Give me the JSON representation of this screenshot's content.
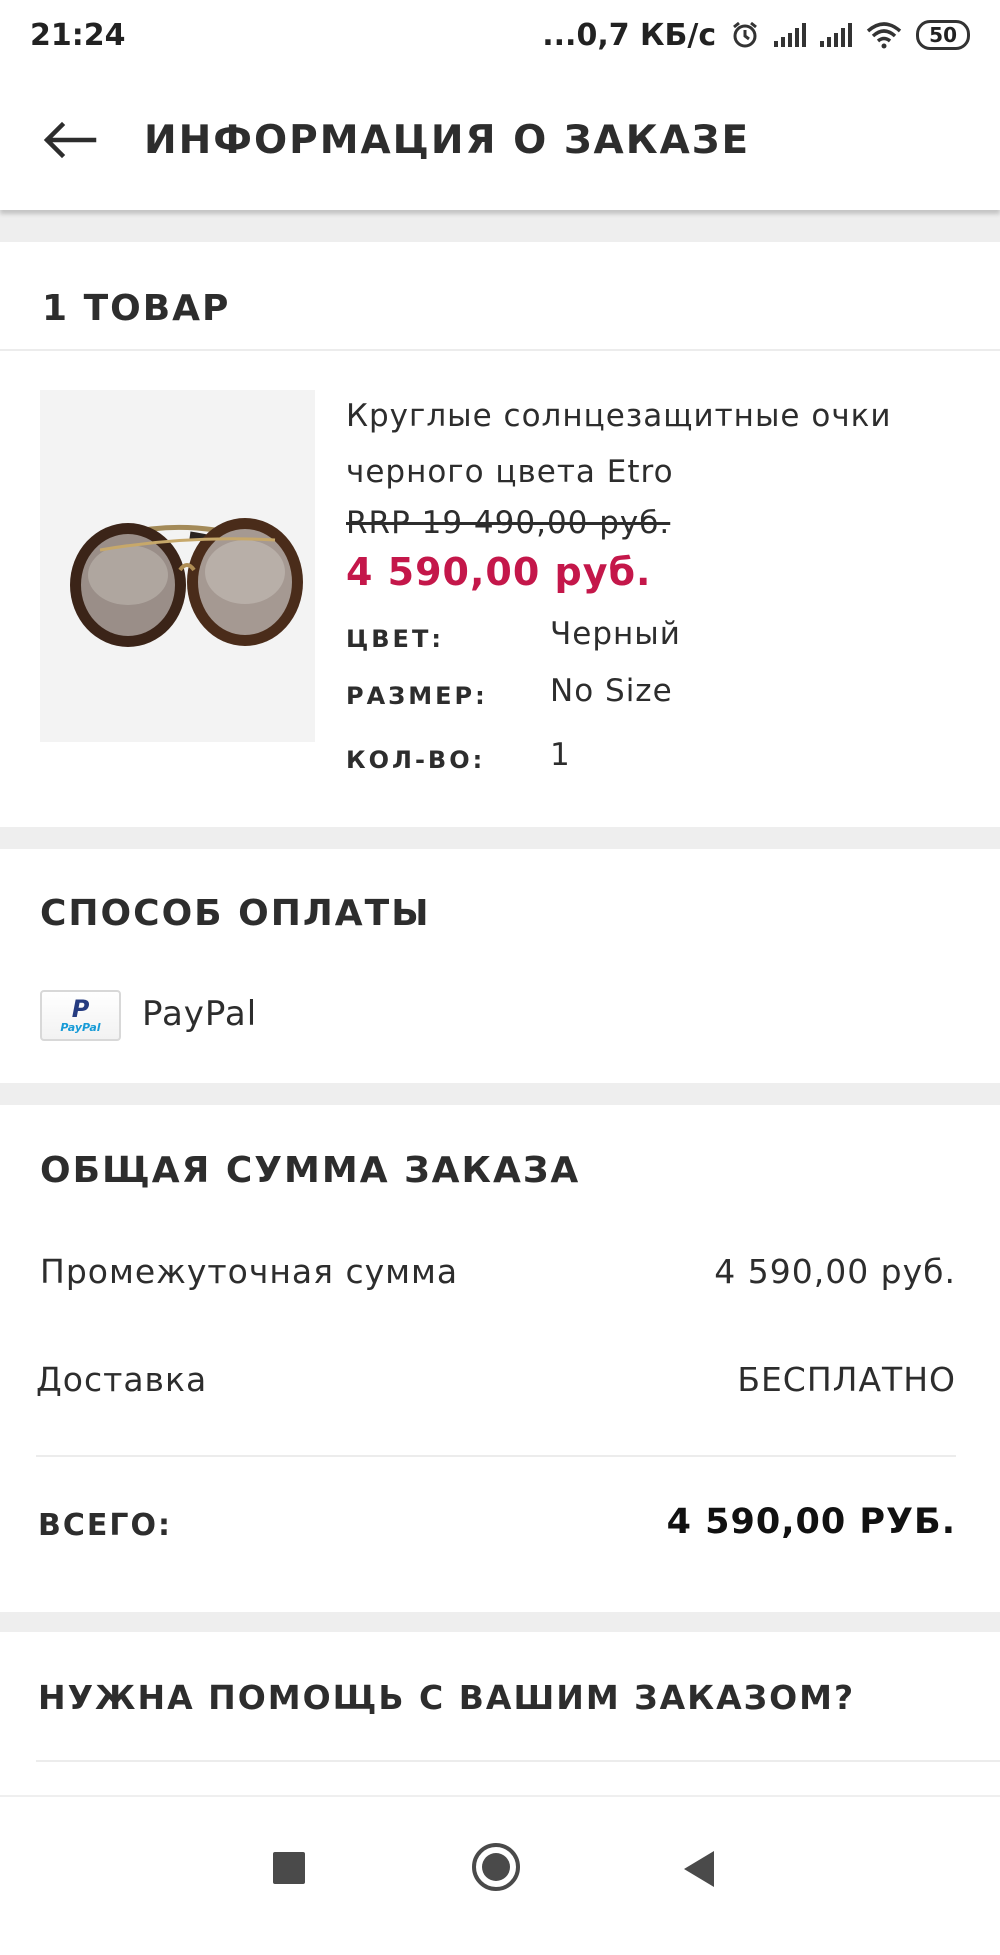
{
  "status_bar": {
    "time": "21:24",
    "network_speed": "...0,7 КБ/с",
    "battery": "50"
  },
  "header": {
    "title": "ИНФОРМАЦИЯ О ЗАКАЗЕ"
  },
  "items_section": {
    "title": "1 ТОВАР",
    "product": {
      "name": "Круглые солнцезащитные очки черного цвета Etro",
      "rrp": "RRP 19 490,00 руб.",
      "price": "4 590,00 руб.",
      "attributes": [
        {
          "label": "ЦВЕТ:",
          "value": "Черный"
        },
        {
          "label": "РАЗМЕР:",
          "value": "No Size"
        },
        {
          "label": "КОЛ-ВО:",
          "value": "1"
        }
      ]
    }
  },
  "payment": {
    "title": "СПОСОБ ОПЛАТЫ",
    "method": "PayPal",
    "logo_text": "PayPal"
  },
  "summary": {
    "title": "ОБЩАЯ СУММА ЗАКАЗА",
    "subtotal_label": "Промежуточная сумма",
    "subtotal_value": "4 590,00 руб.",
    "delivery_label": "Доставка",
    "delivery_value": "БЕСПЛАТНО",
    "total_label": "ВСЕГО:",
    "total_value": "4 590,00 РУБ."
  },
  "help": {
    "title": "НУЖНА ПОМОЩЬ С ВАШИМ ЗАКАЗОМ?"
  },
  "colors": {
    "sale_price": "#c4174a",
    "text": "#2d2d2d",
    "section_gap": "#eeeeee"
  }
}
